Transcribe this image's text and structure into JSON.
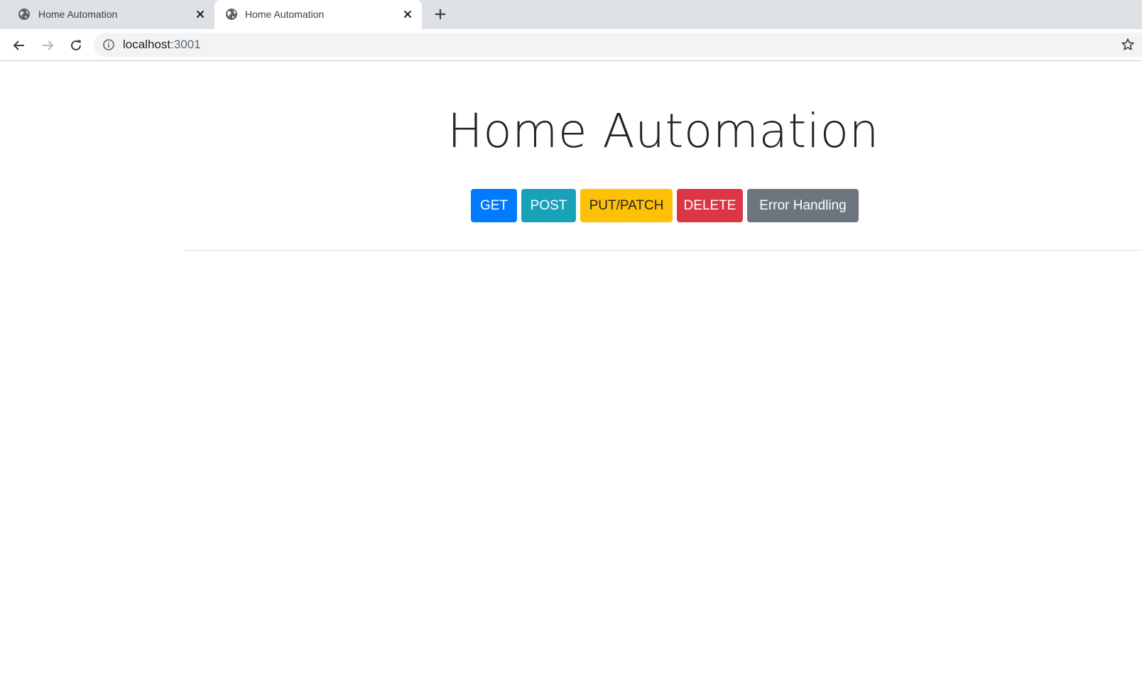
{
  "browser": {
    "tabs": [
      {
        "title": "Home Automation",
        "icon": "globe-icon",
        "active": false
      },
      {
        "title": "Home Automation",
        "icon": "globe-icon",
        "active": true
      }
    ],
    "address_bar": {
      "host": "localhost",
      "port": ":3001"
    }
  },
  "page": {
    "title": "Home Automation",
    "buttons": [
      {
        "label": "GET",
        "color": "#007bff"
      },
      {
        "label": "POST",
        "color": "#17a2b8"
      },
      {
        "label": "PUT/PATCH",
        "color": "#ffc107"
      },
      {
        "label": "DELETE",
        "color": "#dc3545"
      },
      {
        "label": "Error Handling",
        "color": "#6c757d"
      }
    ]
  }
}
